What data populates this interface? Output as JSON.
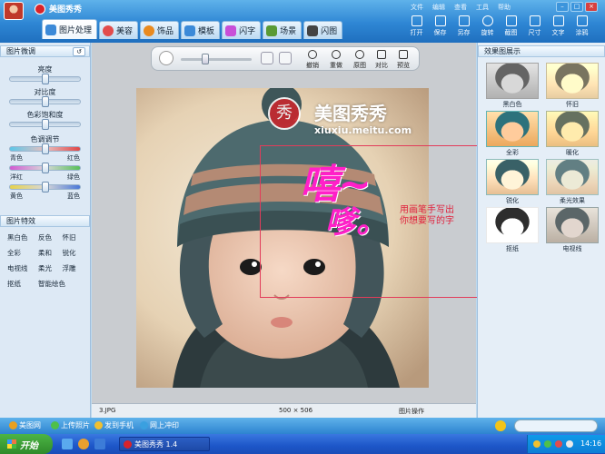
{
  "app": {
    "title": "美图秀秀"
  },
  "menu": [
    "文件",
    "编辑",
    "查看",
    "工具",
    "帮助"
  ],
  "tabs": [
    {
      "label": "图片处理",
      "icon": "photo-icon",
      "color": "#3c8ad8"
    },
    {
      "label": "美容",
      "icon": "face-icon",
      "color": "#e24c4c"
    },
    {
      "label": "饰品",
      "icon": "ornament-icon",
      "color": "#e98a1f"
    },
    {
      "label": "模板",
      "icon": "template-icon",
      "color": "#3c8ad8"
    },
    {
      "label": "闪字",
      "icon": "text-icon",
      "color": "#c84fd8"
    },
    {
      "label": "场景",
      "icon": "scene-icon",
      "color": "#5a9a35"
    },
    {
      "label": "闪图",
      "icon": "flash-icon",
      "color": "#444444"
    }
  ],
  "right_tools": [
    "打开",
    "保存",
    "另存",
    "旋转",
    "截图",
    "尺寸",
    "文字",
    "涂鸦"
  ],
  "left_panel": {
    "adjust_title": "图片微调",
    "brightness": {
      "label": "亮度",
      "level": 0.5
    },
    "contrast": {
      "label": "对比度",
      "level": 0.5
    },
    "saturation": {
      "label": "色彩饱和度",
      "level": 0.5
    },
    "color_title": "色调调节",
    "color_rows": [
      {
        "left": "青色",
        "right": "红色",
        "level": 0.5,
        "gradient": "linear-gradient(90deg,#5cc6e8,#e8c0c0,#e04646)"
      },
      {
        "left": "洋红",
        "right": "绿色",
        "level": 0.5,
        "gradient": "linear-gradient(90deg,#d25ad2,#d8d8d8,#58c058)"
      },
      {
        "left": "黄色",
        "right": "蓝色",
        "level": 0.5,
        "gradient": "linear-gradient(90deg,#e6d24a,#d8d8d8,#4a78d8)"
      }
    ],
    "effects_title": "图片特效",
    "effects": [
      "黑白色",
      "反色",
      "怀旧",
      "全彩",
      "柔和",
      "锐化",
      "电视线",
      "柔光",
      "浮雕",
      "抠纸",
      "智能绘色"
    ]
  },
  "toolbar": {
    "buttons": [
      "撤销",
      "重做",
      "原图",
      "对比",
      "预览"
    ],
    "zoom_level": 0.35
  },
  "canvas": {
    "logo_text": "美图秀秀",
    "logo_badge": "秀",
    "url": "xiuxiu.meitu.com",
    "doodle": "嘻~",
    "doodle_secondary": "嗲。",
    "hint_line1": "用画笔手写出",
    "hint_line2": "你想要写的字"
  },
  "status": {
    "filename": "3.JPG",
    "dimensions": "500 × 506",
    "mode": "图片操作"
  },
  "right_panel": {
    "title": "效果图展示",
    "thumbs": [
      {
        "label": "黑白色",
        "filter": "grayscale(1)"
      },
      {
        "label": "怀旧",
        "filter": "sepia(0.8)"
      },
      {
        "label": "全彩",
        "filter": "saturate(2.4)"
      },
      {
        "label": "暖化",
        "filter": "sepia(0.5) saturate(1.6)"
      },
      {
        "label": "锐化",
        "filter": "contrast(1.4)"
      },
      {
        "label": "柔光效果",
        "filter": "brightness(1.2) contrast(0.85)"
      },
      {
        "label": "抠纸",
        "filter": "grayscale(1) contrast(3)"
      },
      {
        "label": "电视线",
        "filter": "grayscale(0.6)"
      }
    ]
  },
  "bottom_links": [
    "美图网",
    "上传照片",
    "发到手机",
    "网上冲印"
  ],
  "taskbar": {
    "start": "开始",
    "app_item": "美图秀秀 1.4",
    "time": "14:16"
  },
  "colors": {
    "accent": "#2e86d4",
    "doodle": "#ff20c8",
    "hint_text": "#e0203c"
  }
}
